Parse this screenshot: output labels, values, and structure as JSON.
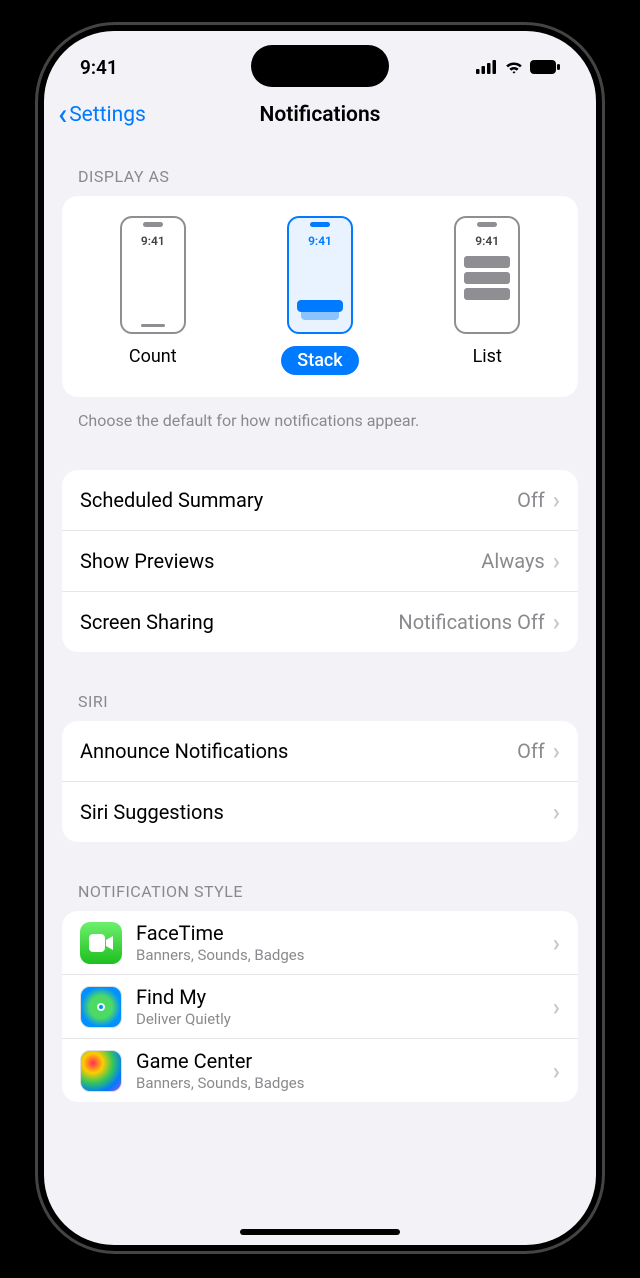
{
  "status": {
    "time": "9:41"
  },
  "nav": {
    "back": "Settings",
    "title": "Notifications"
  },
  "display": {
    "header": "DISPLAY AS",
    "mini_time": "9:41",
    "options": [
      {
        "label": "Count",
        "selected": false
      },
      {
        "label": "Stack",
        "selected": true
      },
      {
        "label": "List",
        "selected": false
      }
    ],
    "footer": "Choose the default for how notifications appear."
  },
  "general_rows": [
    {
      "label": "Scheduled Summary",
      "value": "Off"
    },
    {
      "label": "Show Previews",
      "value": "Always"
    },
    {
      "label": "Screen Sharing",
      "value": "Notifications Off"
    }
  ],
  "siri": {
    "header": "SIRI",
    "rows": [
      {
        "label": "Announce Notifications",
        "value": "Off"
      },
      {
        "label": "Siri Suggestions",
        "value": ""
      }
    ]
  },
  "style": {
    "header": "NOTIFICATION STYLE",
    "apps": [
      {
        "name": "FaceTime",
        "sub": "Banners, Sounds, Badges",
        "icon": "facetime"
      },
      {
        "name": "Find My",
        "sub": "Deliver Quietly",
        "icon": "findmy"
      },
      {
        "name": "Game Center",
        "sub": "Banners, Sounds, Badges",
        "icon": "gamecenter"
      }
    ]
  }
}
